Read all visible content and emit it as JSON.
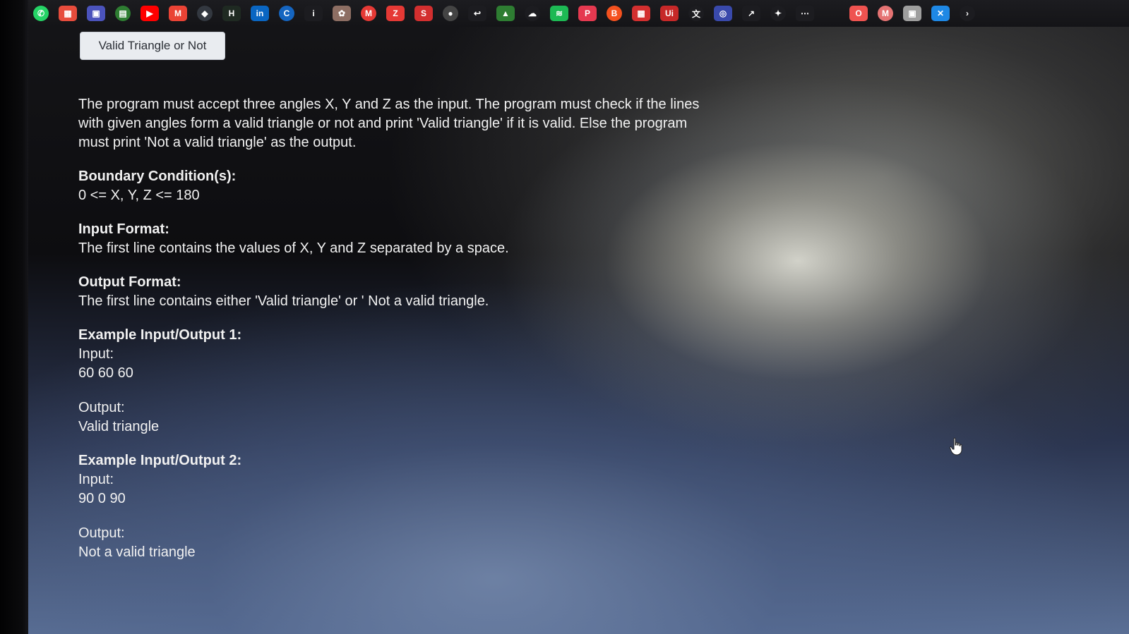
{
  "taskbar": {
    "icons": [
      {
        "name": "whatsapp-icon",
        "color": "#25d366",
        "glyph": "✆"
      },
      {
        "name": "windows-store-icon",
        "color": "#e74c3c",
        "glyph": "▦"
      },
      {
        "name": "teams-icon",
        "color": "#4b53bc",
        "glyph": "▣"
      },
      {
        "name": "photos-icon",
        "color": "#2e7d32",
        "glyph": "▤"
      },
      {
        "name": "youtube-icon",
        "color": "#ff0000",
        "glyph": "▶"
      },
      {
        "name": "gmail-icon",
        "color": "#ea4335",
        "glyph": "M"
      },
      {
        "name": "app-icon",
        "color": "#333840",
        "glyph": "◆"
      },
      {
        "name": "hackerrank-icon",
        "color": "#1f2a22",
        "glyph": "H"
      },
      {
        "name": "linkedin-icon",
        "color": "#0a66c2",
        "glyph": "in"
      },
      {
        "name": "c-app-icon",
        "color": "#1565c0",
        "glyph": "C"
      },
      {
        "name": "info-icon",
        "color": "#1c1c20",
        "glyph": "i"
      },
      {
        "name": "extension-icon",
        "color": "#8d6e63",
        "glyph": "✿"
      },
      {
        "name": "mail-icon",
        "color": "#e53935",
        "glyph": "M"
      },
      {
        "name": "z-app-icon",
        "color": "#e53935",
        "glyph": "Z"
      },
      {
        "name": "s-app-icon",
        "color": "#d32f2f",
        "glyph": "S"
      },
      {
        "name": "github-icon",
        "color": "#444",
        "glyph": "●"
      },
      {
        "name": "tool-icon",
        "color": "#1c1c20",
        "glyph": "↩"
      },
      {
        "name": "shield-icon",
        "color": "#2e7d32",
        "glyph": "▲"
      },
      {
        "name": "cloud-icon",
        "color": "#1c1c20",
        "glyph": "☁"
      },
      {
        "name": "spotify-icon",
        "color": "#1db954",
        "glyph": "≋"
      },
      {
        "name": "pinterest-icon",
        "color": "#e53950",
        "glyph": "P"
      },
      {
        "name": "blogger-icon",
        "color": "#f4511e",
        "glyph": "B"
      },
      {
        "name": "calendar-icon",
        "color": "#d32f2f",
        "glyph": "▦"
      },
      {
        "name": "ui-app-icon",
        "color": "#c62828",
        "glyph": "Ui"
      },
      {
        "name": "translate-icon",
        "color": "#1c1c20",
        "glyph": "文"
      },
      {
        "name": "safari-icon",
        "color": "#3949ab",
        "glyph": "◎"
      },
      {
        "name": "arrow-icon",
        "color": "#1c1c20",
        "glyph": "↗"
      },
      {
        "name": "puzzle-icon",
        "color": "#1c1c20",
        "glyph": "✦"
      },
      {
        "name": "dots-icon",
        "color": "#1c1c20",
        "glyph": "⋯"
      },
      {
        "name": "opera-icon",
        "color": "#ef5350",
        "glyph": "O"
      },
      {
        "name": "m-app-icon",
        "color": "#e57373",
        "glyph": "M"
      },
      {
        "name": "profile-icon",
        "color": "#9e9e9e",
        "glyph": "▣"
      },
      {
        "name": "settings-icon",
        "color": "#1e88e5",
        "glyph": "✕"
      },
      {
        "name": "chevron-right-icon",
        "color": "#1c1c20",
        "glyph": "›"
      }
    ]
  },
  "tab": {
    "title": "Valid Triangle or Not"
  },
  "problem": {
    "description": "The program must accept three angles X, Y and Z as the input. The program must check if the lines with given angles form a valid triangle or not and print 'Valid triangle' if it is valid. Else the program must print 'Not a valid triangle' as the output.",
    "boundary": {
      "heading": "Boundary Condition(s):",
      "text": "0 <= X, Y, Z <= 180"
    },
    "input_format": {
      "heading": "Input Format:",
      "text": "The first line contains the values of X, Y and Z separated by a space."
    },
    "output_format": {
      "heading": "Output Format:",
      "text": "The first line contains either 'Valid triangle' or ' Not a valid triangle."
    },
    "example1": {
      "heading": "Example Input/Output 1:",
      "input_label": "Input:",
      "input_value": "60 60 60",
      "output_label": "Output:",
      "output_value": "Valid triangle"
    },
    "example2": {
      "heading": "Example Input/Output 2:",
      "input_label": "Input:",
      "input_value": "90 0 90",
      "output_label": "Output:",
      "output_value": "Not a valid triangle"
    }
  }
}
